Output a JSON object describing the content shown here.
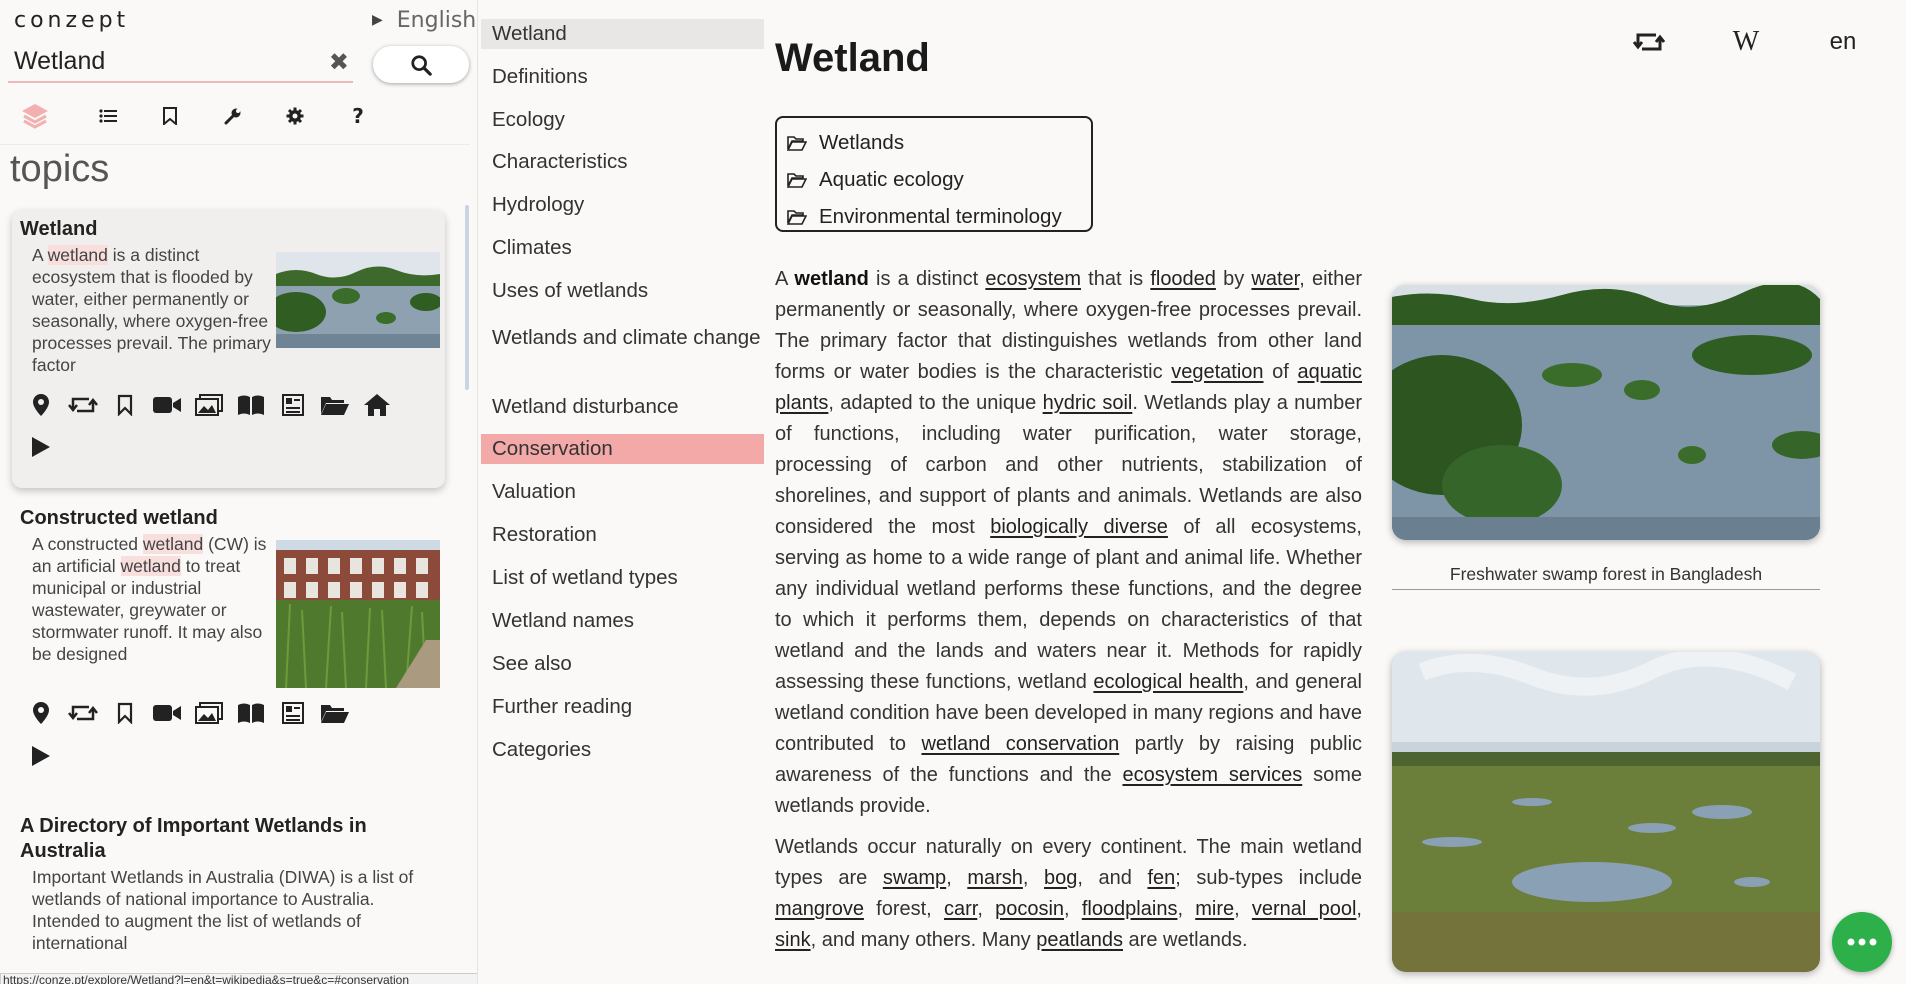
{
  "app": {
    "brand": "conzept",
    "language": "English"
  },
  "search": {
    "value": "Wetland"
  },
  "topics_heading": "topics",
  "cards": [
    {
      "title": "Wetland",
      "text_parts": [
        "A ",
        "wetland",
        " is a distinct ecosystem that is flooded by water, either perma­nently or seasonally, where oxygen-free processes pre­vail. The primary factor"
      ]
    },
    {
      "title": "Constructed wetland",
      "text_parts": [
        "A constructed ",
        "wetland",
        " (CW) is an artificial ",
        "wetland",
        " to treat municipal or indus­trial wastewater, greywater or stormwater runoff. It may also be designed"
      ]
    },
    {
      "title": "A Directory of Important Wetlands in Australia",
      "text": "Important Wetlands in Australia (DIWA) is a list of wetlands of national importance to Australia. Intended to augment the list of wet­lands of international"
    }
  ],
  "status_url": "https://conze.pt/explore/Wetland?l=en&t=wikipedia&s=true&c=#conservation",
  "toc": {
    "items": [
      "Wetland",
      "Definitions",
      "Ecology",
      "Characteristics",
      "Hydrology",
      "Climates",
      "Uses of wetlands",
      "Wetlands and climate change",
      "Wetland disturbance",
      "Conservation",
      "Valuation",
      "Restoration",
      "List of wetland types",
      "Wetland names",
      "See also",
      "Further reading",
      "Categories"
    ],
    "current": "Wetland",
    "selected": "Conservation"
  },
  "article": {
    "title": "Wetland",
    "lang_label": "en",
    "categories": [
      "Wetlands",
      "Aquatic ecology",
      "Environmental terminology"
    ],
    "figures": [
      {
        "caption": "Freshwater swamp forest in Bangladesh"
      },
      {
        "caption": ""
      }
    ],
    "paragraph1": [
      [
        "t",
        "A "
      ],
      [
        "b",
        "wetland"
      ],
      [
        "t",
        " is a distinct "
      ],
      [
        "a",
        "ecosystem"
      ],
      [
        "t",
        " that is "
      ],
      [
        "a",
        "flooded"
      ],
      [
        "t",
        " by "
      ],
      [
        "a",
        "water"
      ],
      [
        "t",
        ", either permanently or seasonally, where oxygen-free processes prevail. The primary factor that distinguishes wetlands from other land forms or water bodies is the characteristic "
      ],
      [
        "a",
        "vegetation"
      ],
      [
        "t",
        " of "
      ],
      [
        "a",
        "aquatic plants"
      ],
      [
        "t",
        ", adapted to the unique "
      ],
      [
        "a",
        "hydric soil"
      ],
      [
        "t",
        ". Wetlands play a number of functions, including water purification, water storage, processing of carbon and other nutrients, stabilization of shorelines, and support of plants and animals. Wetlands are also considered the most "
      ],
      [
        "a",
        "biologically diverse"
      ],
      [
        "t",
        " of all ecosystems, serving as home to a wide range of plant and animal life. Whether any individual wetland performs these functions, and the degree to which it performs them, depends on characteristics of that wetland and the lands and waters near it. Methods for rapidly assessing these functions, wetland "
      ],
      [
        "a",
        "ecological health"
      ],
      [
        "t",
        ", and general wetland condition have been developed in many regions and have contributed to "
      ],
      [
        "a",
        "wetland conservation"
      ],
      [
        "t",
        " partly by raising public awareness of the functions and the "
      ],
      [
        "a",
        "ecosystem services"
      ],
      [
        "t",
        " some wetlands provide."
      ]
    ],
    "paragraph2": [
      [
        "t",
        "Wetlands occur naturally on every continent. The main wetland types are "
      ],
      [
        "a",
        "swamp"
      ],
      [
        "t",
        ", "
      ],
      [
        "a",
        "marsh"
      ],
      [
        "t",
        ", "
      ],
      [
        "a",
        "bog"
      ],
      [
        "t",
        ", and "
      ],
      [
        "a",
        "fen"
      ],
      [
        "t",
        "; sub-types include "
      ],
      [
        "a",
        "mangrove"
      ],
      [
        "t",
        " forest, "
      ],
      [
        "a",
        "carr"
      ],
      [
        "t",
        ", "
      ],
      [
        "a",
        "pocosin"
      ],
      [
        "t",
        ", "
      ],
      [
        "a",
        "floodplains"
      ],
      [
        "t",
        ", "
      ],
      [
        "a",
        "mire"
      ],
      [
        "t",
        ", "
      ],
      [
        "a",
        "vernal pool"
      ],
      [
        "t",
        ", "
      ],
      [
        "a",
        "sink"
      ],
      [
        "t",
        ", and many others. Many "
      ],
      [
        "a",
        "peatlands"
      ],
      [
        "t",
        " are wetlands."
      ]
    ]
  }
}
